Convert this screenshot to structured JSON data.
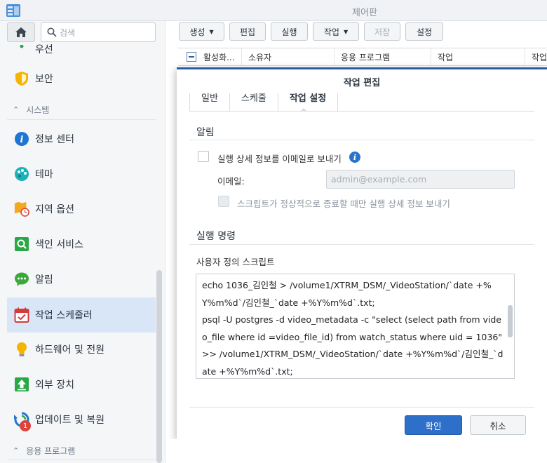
{
  "window": {
    "title": "제어판"
  },
  "sidebar": {
    "search_placeholder": "검색",
    "partial_item": "우선",
    "items": [
      {
        "label": "보안",
        "icon": "shield-icon"
      },
      {
        "label": "정보 센터",
        "icon": "info-icon"
      },
      {
        "label": "테마",
        "icon": "palette-icon"
      },
      {
        "label": "지역 옵션",
        "icon": "map-clock-icon"
      },
      {
        "label": "색인 서비스",
        "icon": "index-search-icon"
      },
      {
        "label": "알림",
        "icon": "chat-bubble-icon"
      },
      {
        "label": "작업 스케줄러",
        "icon": "calendar-check-icon"
      },
      {
        "label": "하드웨어 및 전원",
        "icon": "bulb-icon"
      },
      {
        "label": "외부 장치",
        "icon": "upload-device-icon"
      },
      {
        "label": "업데이트 및 복원",
        "icon": "update-restore-icon",
        "badge": "1"
      }
    ],
    "sections": {
      "system": "시스템",
      "apps": "응용 프로그램"
    }
  },
  "toolbar": {
    "create": "생성",
    "edit": "편집",
    "run": "실행",
    "action": "작업",
    "save": "저장",
    "settings": "설정"
  },
  "table": {
    "headers": [
      "활성화...",
      "소유자",
      "응용 프로그램",
      "작업",
      "작업"
    ]
  },
  "dialog": {
    "title": "작업 편집",
    "tabs": [
      "일반",
      "스케줄",
      "작업 설정"
    ],
    "notification": {
      "section": "알림",
      "email_detail_label": "실행 상세 정보를 이메일로 보내기",
      "email_label": "이메일:",
      "email_placeholder": "admin@example.com",
      "abnormal_only_label": "스크립트가 정상적으로 종료할 때만 실행 상세 정보 보내기"
    },
    "run_command": {
      "section": "실행 명령",
      "script_label": "사용자 정의 스크립트",
      "script": "echo 1036_김인철 > /volume1/XTRM_DSM/_VideoStation/`date +%Y%m%d`/김인철_`date +%Y%m%d`.txt;\npsql -U postgres -d video_metadata -c \"select (select path from video_file where id =video_file_id) from watch_status where uid = 1036\" >> /volume1/XTRM_DSM/_VideoStation/`date +%Y%m%d`/김인철_`date +%Y%m%d`.txt;"
    },
    "ok": "확인",
    "cancel": "취소"
  },
  "colors": {
    "accent": "#2d6fc9",
    "dialog_border": "#2a5d9d",
    "active_item": "#d8e6f8"
  }
}
